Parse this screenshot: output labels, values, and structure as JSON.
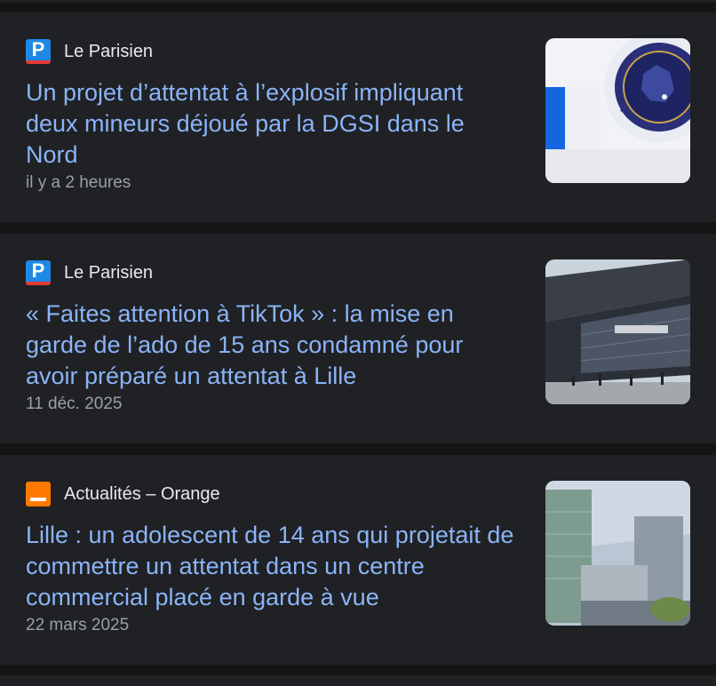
{
  "articles": [
    {
      "source": "Le Parisien",
      "favicon": "le-parisien-logo",
      "favicon_letter": "P",
      "headline": "Un projet d’attentat à l’explosif impliquant deux mineurs déjoué par la DGSI dans le Nord",
      "time": "il y a 2 heures",
      "thumbnail": "dgsi-emblem-photo"
    },
    {
      "source": "Le Parisien",
      "favicon": "le-parisien-logo",
      "favicon_letter": "P",
      "headline": "« Faites attention à TikTok » : la mise en garde de l’ado de 15 ans condamné pour avoir préparé un attentat à Lille",
      "time": "11 déc. 2025",
      "thumbnail": "euralille-building-photo"
    },
    {
      "source": "Actualités – Orange",
      "favicon": "orange-logo",
      "headline": "Lille : un adolescent de 14 ans qui projetait de commettre un attentat dans un centre commercial placé en garde à vue",
      "time": "22 mars 2025",
      "thumbnail": "lille-office-towers-photo"
    }
  ],
  "colors": {
    "background": "#151515",
    "card": "#202124",
    "headline": "#8ab4f8",
    "source": "#e8eaed",
    "timestamp": "#9aa0a6"
  }
}
